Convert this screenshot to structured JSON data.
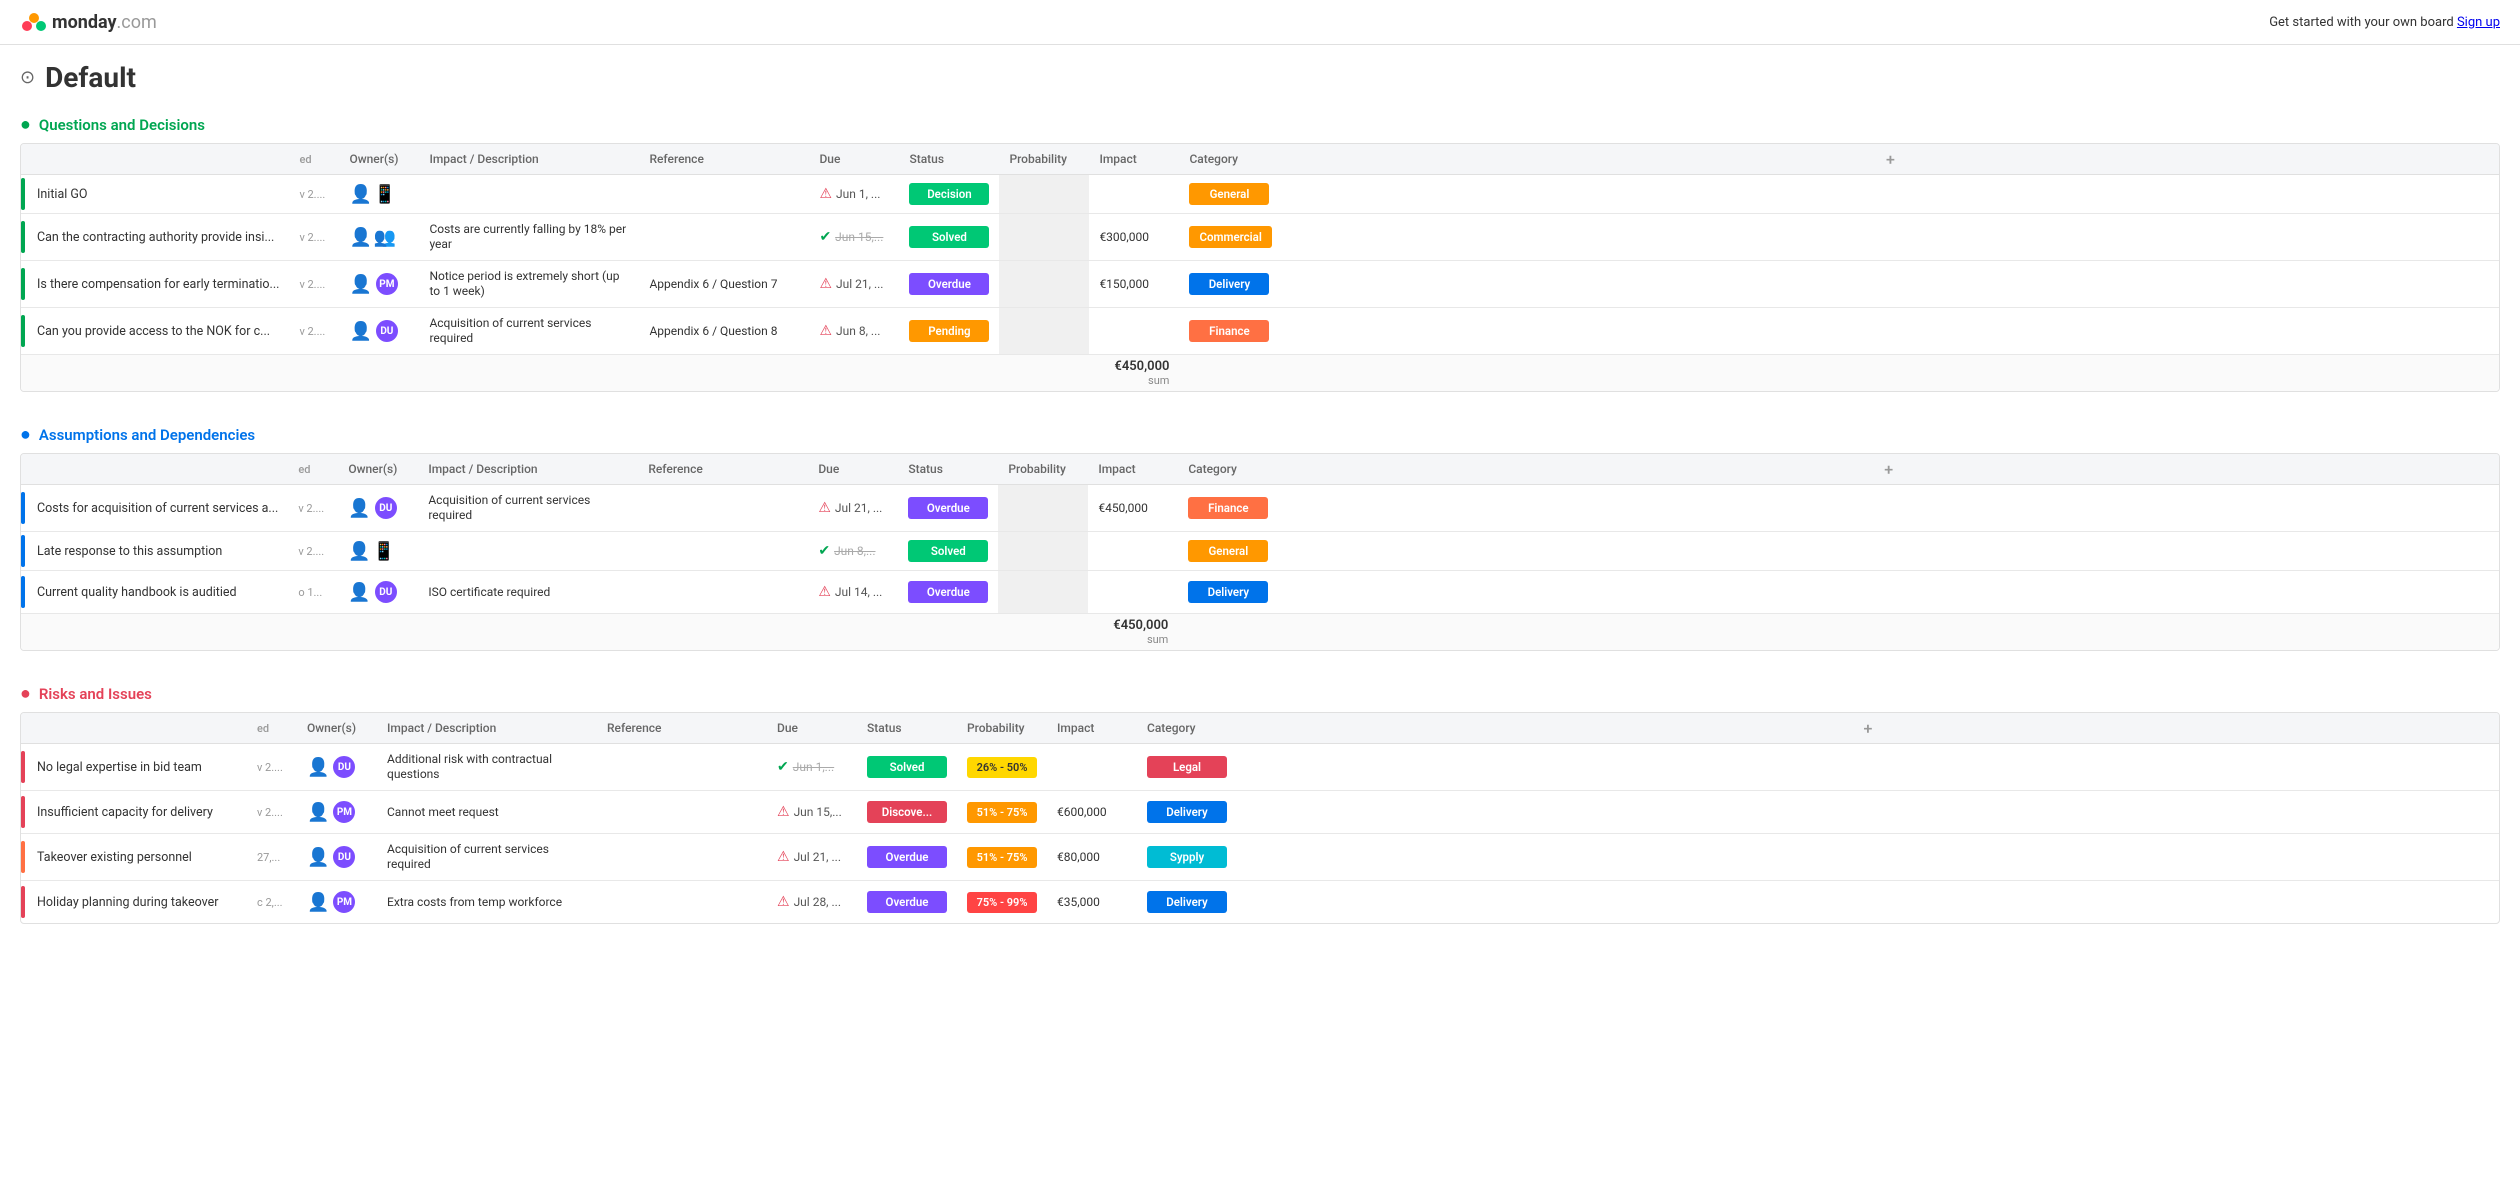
{
  "header": {
    "logo_text": "monday",
    "logo_com": ".com",
    "cta_text": "Get started with your own board",
    "cta_link": "Sign up"
  },
  "page": {
    "title": "Default",
    "share_icon": "⊙"
  },
  "sections": [
    {
      "id": "questions",
      "title": "Questions and Decisions",
      "color_class": "section-title-qd",
      "toggle_color": "#00a651",
      "indicator_class": "indicator-green",
      "columns": [
        "",
        "",
        "Owner(s)",
        "Impact / Description",
        "Reference",
        "Due",
        "Status",
        "Probability",
        "Impact",
        "Category",
        "+"
      ],
      "rows": [
        {
          "name": "Initial GO",
          "version": "v 2....",
          "owners": [
            {
              "type": "icon"
            },
            {
              "type": "icon"
            }
          ],
          "impact_desc": "",
          "reference": "",
          "due_icon": "red",
          "due_text": "Jun 1, ...",
          "status": "Decision",
          "status_class": "status-decision",
          "probability": "",
          "impact_val": "",
          "category": "General",
          "cat_class": "cat-general",
          "indicator_class": "indicator-green"
        },
        {
          "name": "Can the contracting authority provide insi...",
          "version": "v 2....",
          "owners": [
            {
              "type": "icon"
            },
            {
              "type": "icon"
            }
          ],
          "impact_desc": "Costs are currently falling by 18% per year",
          "reference": "",
          "due_icon": "green",
          "due_text": "Jun 15,...",
          "due_strike": true,
          "status": "Solved",
          "status_class": "status-solved",
          "probability": "",
          "impact_val": "€300,000",
          "category": "Commercial",
          "cat_class": "cat-commercial",
          "indicator_class": "indicator-green"
        },
        {
          "name": "Is there compensation for early terminatio...",
          "version": "v 2....",
          "owners": [
            {
              "type": "icon"
            },
            {
              "type": "avatar",
              "initials": "PM",
              "class": "avatar-purple"
            }
          ],
          "impact_desc": "Notice period is extremely short (up to 1 week)",
          "reference": "Appendix 6 / Question 7",
          "due_icon": "red",
          "due_text": "Jul 21, ...",
          "status": "Overdue",
          "status_class": "status-overdue",
          "probability": "",
          "impact_val": "€150,000",
          "category": "Delivery",
          "cat_class": "cat-delivery",
          "indicator_class": "indicator-green"
        },
        {
          "name": "Can you provide access to the NOK for c...",
          "version": "v 2....",
          "owners": [
            {
              "type": "icon"
            },
            {
              "type": "avatar",
              "initials": "DU",
              "class": "avatar-purple"
            }
          ],
          "impact_desc": "Acquisition of current services required",
          "reference": "Appendix 6 / Question 8",
          "due_icon": "red",
          "due_text": "Jun 8, ...",
          "status": "Pending",
          "status_class": "status-pending",
          "probability": "",
          "impact_val": "",
          "category": "Finance",
          "cat_class": "cat-finance",
          "indicator_class": "indicator-green"
        }
      ],
      "sum_val": "€450,000",
      "sum_label": "sum"
    },
    {
      "id": "assumptions",
      "title": "Assumptions and Dependencies",
      "color_class": "section-title-ad",
      "toggle_color": "#0073ea",
      "indicator_class": "indicator-blue",
      "columns": [
        "",
        "",
        "Owner(s)",
        "Impact / Description",
        "Reference",
        "Due",
        "Status",
        "Probability",
        "Impact",
        "Category",
        "+"
      ],
      "rows": [
        {
          "name": "Costs for acquisition of current services a...",
          "version": "v 2....",
          "owners": [
            {
              "type": "icon"
            },
            {
              "type": "avatar",
              "initials": "DU",
              "class": "avatar-purple"
            }
          ],
          "impact_desc": "Acquisition of current services required",
          "reference": "",
          "due_icon": "red",
          "due_text": "Jul 21, ...",
          "status": "Overdue",
          "status_class": "status-overdue",
          "probability": "",
          "impact_val": "€450,000",
          "category": "Finance",
          "cat_class": "cat-finance",
          "indicator_class": "indicator-blue"
        },
        {
          "name": "Late response to this assumption",
          "version": "v 2....",
          "owners": [
            {
              "type": "icon"
            },
            {
              "type": "icon"
            }
          ],
          "impact_desc": "",
          "reference": "",
          "due_icon": "green",
          "due_text": "Jun 8,...",
          "due_strike": true,
          "status": "Solved",
          "status_class": "status-solved",
          "probability": "",
          "impact_val": "",
          "category": "General",
          "cat_class": "cat-general",
          "indicator_class": "indicator-blue"
        },
        {
          "name": "Current quality handbook is auditied",
          "version": "o 1...",
          "owners": [
            {
              "type": "icon"
            },
            {
              "type": "avatar",
              "initials": "DU",
              "class": "avatar-purple"
            }
          ],
          "impact_desc": "ISO certificate required",
          "reference": "",
          "due_icon": "red",
          "due_text": "Jul 14, ...",
          "status": "Overdue",
          "status_class": "status-overdue",
          "probability": "",
          "impact_val": "",
          "category": "Delivery",
          "cat_class": "cat-delivery",
          "indicator_class": "indicator-blue"
        }
      ],
      "sum_val": "€450,000",
      "sum_label": "sum"
    },
    {
      "id": "risks",
      "title": "Risks and Issues",
      "color_class": "section-title-ri",
      "toggle_color": "#e44258",
      "indicator_class": "indicator-red",
      "columns": [
        "",
        "",
        "Owner(s)",
        "Impact / Description",
        "Reference",
        "Due",
        "Status",
        "Probability",
        "Impact",
        "Category",
        "+"
      ],
      "rows": [
        {
          "name": "No legal expertise in bid team",
          "version": "v 2....",
          "owners": [
            {
              "type": "icon"
            },
            {
              "type": "avatar",
              "initials": "DU",
              "class": "avatar-purple"
            }
          ],
          "impact_desc": "Additional risk with contractual questions",
          "reference": "",
          "due_icon": "green",
          "due_text": "Jun 1,...",
          "due_strike": true,
          "status": "Solved",
          "status_class": "status-solved",
          "probability": "26% - 50%",
          "prob_class": "prob-26-50",
          "impact_val": "",
          "category": "Legal",
          "cat_class": "cat-legal",
          "indicator_class": "indicator-red"
        },
        {
          "name": "Insufficient capacity for delivery",
          "version": "v 2....",
          "owners": [
            {
              "type": "icon"
            },
            {
              "type": "avatar",
              "initials": "PM",
              "class": "avatar-purple"
            }
          ],
          "impact_desc": "Cannot meet request",
          "reference": "",
          "due_icon": "red",
          "due_text": "Jun 15,...",
          "status": "Discove...",
          "status_class": "status-discover",
          "probability": "51% - 75%",
          "prob_class": "prob-51-75",
          "impact_val": "€600,000",
          "category": "Delivery",
          "cat_class": "cat-delivery",
          "indicator_class": "indicator-red"
        },
        {
          "name": "Takeover existing personnel",
          "version": "27,...",
          "owners": [
            {
              "type": "icon"
            },
            {
              "type": "avatar",
              "initials": "DU",
              "class": "avatar-purple"
            }
          ],
          "impact_desc": "Acquisition of current services required",
          "reference": "",
          "due_icon": "red",
          "due_text": "Jul 21, ...",
          "status": "Overdue",
          "status_class": "status-overdue",
          "probability": "51% - 75%",
          "prob_class": "prob-51-75",
          "impact_val": "€80,000",
          "category": "Sypply",
          "cat_class": "cat-supply",
          "indicator_class": "indicator-orange"
        },
        {
          "name": "Holiday planning during takeover",
          "version": "c 2,...",
          "owners": [
            {
              "type": "icon"
            },
            {
              "type": "avatar",
              "initials": "PM",
              "class": "avatar-purple"
            }
          ],
          "impact_desc": "Extra costs from temp workforce",
          "reference": "",
          "due_icon": "red",
          "due_text": "Jul 28, ...",
          "status": "Overdue",
          "status_class": "status-overdue",
          "probability": "75% - 99%",
          "prob_class": "prob-75-99",
          "impact_val": "€35,000",
          "category": "Delivery",
          "cat_class": "cat-delivery",
          "indicator_class": "indicator-red"
        }
      ],
      "sum_val": "",
      "sum_label": ""
    }
  ]
}
